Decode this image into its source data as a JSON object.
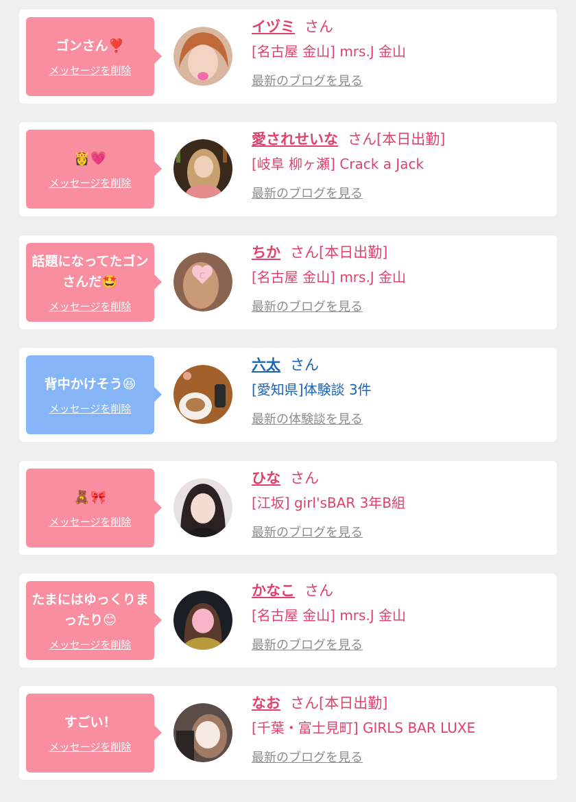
{
  "colors": {
    "pink_bubble": "#f98ea0",
    "blue_bubble": "#85b5f7",
    "pink_text": "#e0416a",
    "blue_text": "#1a63b8",
    "link_gray": "#8c8c8c",
    "page_bg": "#efefef"
  },
  "entries": [
    {
      "message": "ゴンさん❣️",
      "delete_label": "メッセージを削除",
      "name": "イヅミ",
      "suffix": "さん",
      "location": "[名古屋 金山] mrs.J 金山",
      "link": "最新のブログを見る",
      "theme": "pink",
      "avatar": "photo-woman-orange-hair"
    },
    {
      "message": "👸💗",
      "delete_label": "メッセージを削除",
      "name": "愛されせいな",
      "suffix": "さん[本日出勤]",
      "location": "[岐阜 柳ヶ瀬] Crack a Jack",
      "link": "最新のブログを見る",
      "theme": "pink",
      "avatar": "photo-woman-bar-background"
    },
    {
      "message": "話題になってたゴンさんだ🤩",
      "delete_label": "メッセージを削除",
      "name": "ちか",
      "suffix": "さん[本日出勤]",
      "location": "[名古屋 金山] mrs.J 金山",
      "link": "最新のブログを見る",
      "theme": "pink",
      "avatar": "photo-woman-heart-sticker"
    },
    {
      "message": "背中かけそう😆",
      "delete_label": "メッセージを削除",
      "name": "六太",
      "suffix": "さん",
      "location": "[愛知県]体験談 3件",
      "link": "最新の体験談を見る",
      "theme": "blue",
      "avatar": "photo-food-plate"
    },
    {
      "message": "🧸🎀",
      "delete_label": "メッセージを削除",
      "name": "ひな",
      "suffix": "さん",
      "location": "[江坂] girl'sBAR 3年B組",
      "link": "最新のブログを見る",
      "theme": "pink",
      "avatar": "photo-woman-dark-hair"
    },
    {
      "message": "たまにはゆっくりまったり😊",
      "delete_label": "メッセージを削除",
      "name": "かなこ",
      "suffix": "さん",
      "location": "[名古屋 金山] mrs.J 金山",
      "link": "最新のブログを見る",
      "theme": "pink",
      "avatar": "photo-woman-mosaic-face"
    },
    {
      "message": "すごい！",
      "delete_label": "メッセージを削除",
      "name": "なお",
      "suffix": "さん[本日出勤]",
      "location": "[千葉・富士見町] GIRLS BAR LUXE",
      "link": "最新のブログを見る",
      "theme": "pink",
      "avatar": "photo-woman-selfie"
    }
  ]
}
